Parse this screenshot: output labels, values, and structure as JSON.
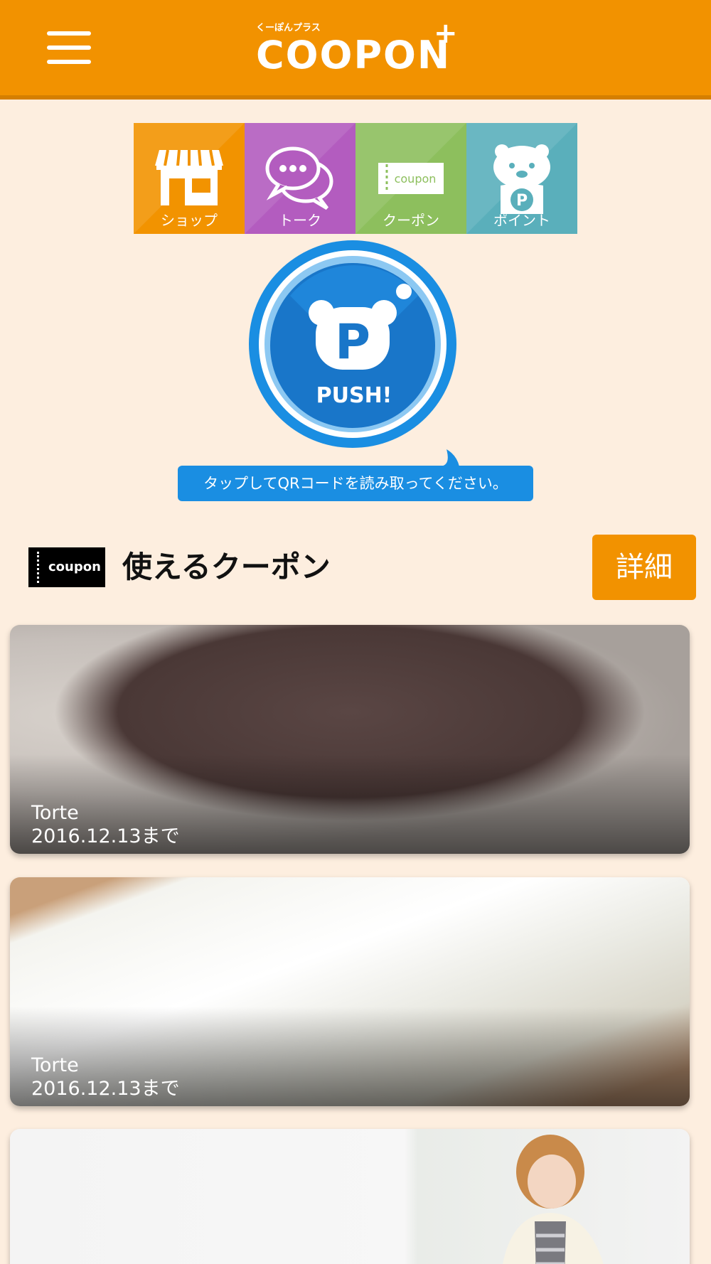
{
  "header": {
    "logo_kana": "くーぽんプラス",
    "logo_text": "COOPON",
    "logo_plus": "+"
  },
  "tiles": [
    {
      "label": "ショップ",
      "icon": "shop-icon",
      "color": "#f29300"
    },
    {
      "label": "トーク",
      "icon": "chat-bubbles-icon",
      "color": "#b35cbf"
    },
    {
      "label": "クーポン",
      "icon": "coupon-ticket-icon",
      "color": "#8dbf5d"
    },
    {
      "label": "ポイント",
      "icon": "bear-point-icon",
      "color": "#5aafbb"
    }
  ],
  "push": {
    "letter": "P",
    "label": "PUSH!",
    "hint": "タップしてQRコードを読み取ってください。"
  },
  "section": {
    "icon_text": "coupon",
    "title": "使えるクーポン",
    "detail_label": "詳細"
  },
  "coupons": [
    {
      "title": "Torte",
      "date": "2016.12.13まで"
    },
    {
      "title": "Torte",
      "date": "2016.12.13まで"
    }
  ],
  "colors": {
    "header": "#f29200",
    "background": "#fdeedf",
    "push_blue": "#1a8ee2",
    "accent": "#f29200"
  }
}
